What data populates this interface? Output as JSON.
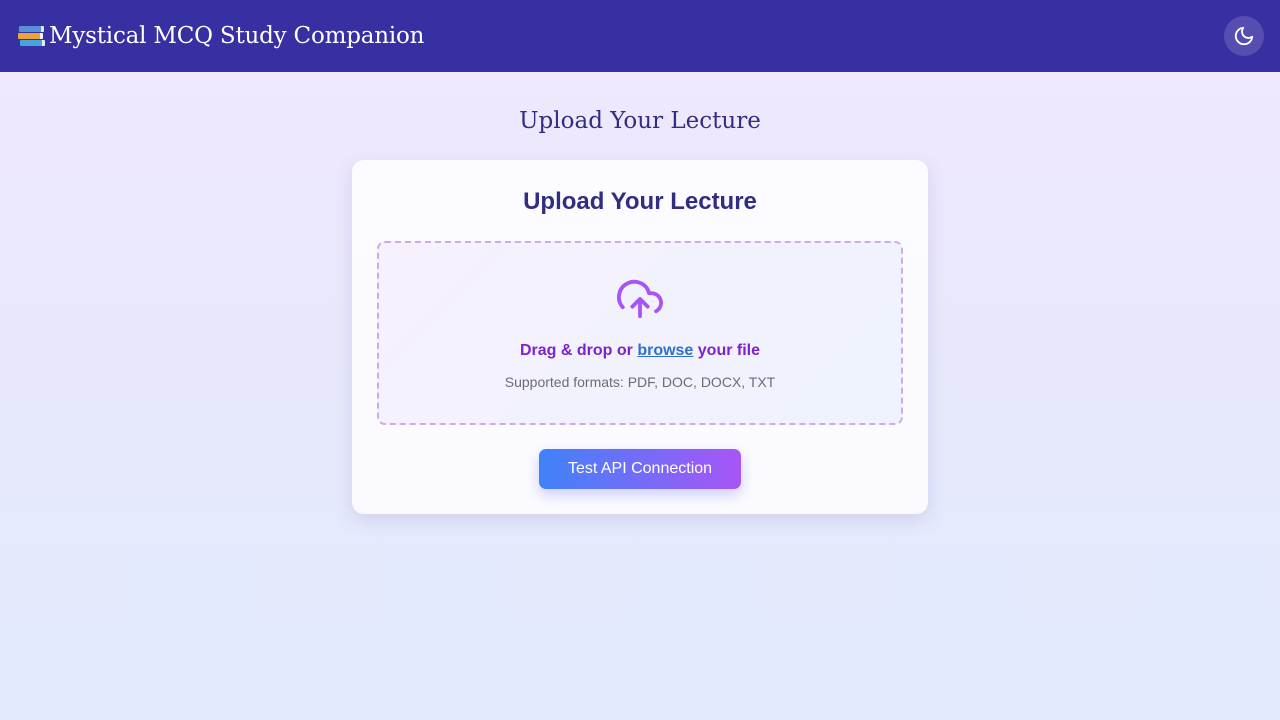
{
  "header": {
    "title": "Mystical MCQ Study Companion",
    "brand_icon": "books-icon",
    "theme_toggle_icon": "moon-icon",
    "background_color": "#3730a3"
  },
  "page": {
    "heading": "Upload Your Lecture"
  },
  "upload_card": {
    "title": "Upload Your Lecture",
    "dropzone": {
      "icon": "cloud-upload-icon",
      "prompt_prefix": "Drag & drop or ",
      "browse_label": "browse",
      "prompt_suffix": " your file",
      "supported_formats": "Supported formats: PDF, DOC, DOCX, TXT"
    },
    "api_button_label": "Test API Connection"
  },
  "colors": {
    "accent_purple": "#7e22ce",
    "link_blue": "#2f6fd0",
    "heading_indigo": "#312e81",
    "button_gradient_start": "#3f83f8",
    "button_gradient_end": "#a855f7"
  }
}
